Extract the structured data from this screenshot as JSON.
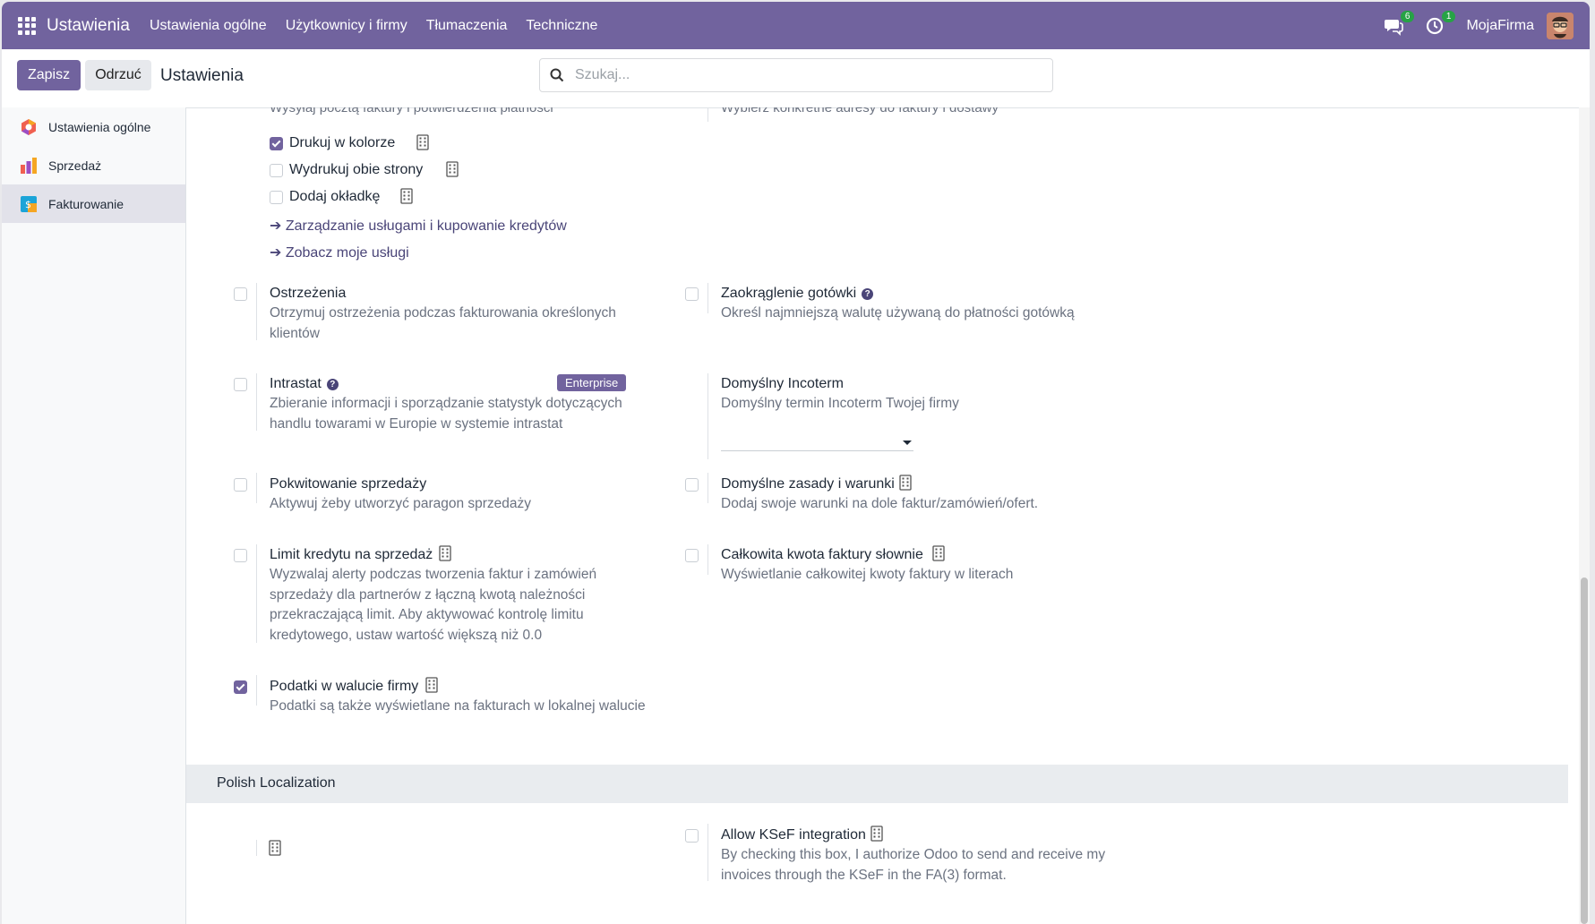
{
  "topbar": {
    "brand": "Ustawienia",
    "menu": [
      "Ustawienia ogólne",
      "Użytkownicy i firmy",
      "Tłumaczenia",
      "Techniczne"
    ],
    "messages_count": "6",
    "activities_count": "1",
    "company": "MojaFirma"
  },
  "controlbar": {
    "save_label": "Zapisz",
    "discard_label": "Odrzuć",
    "title": "Ustawienia",
    "search_placeholder": "Szukaj..."
  },
  "sidebar": {
    "items": [
      {
        "label": "Ustawienia ogólne",
        "active": false
      },
      {
        "label": "Sprzedaż",
        "active": false
      },
      {
        "label": "Fakturowanie",
        "active": true
      }
    ]
  },
  "content": {
    "clipped_left": "Wysyłaj pocztą faktury i potwierdzenia płatności",
    "clipped_right": "Wybierz konkretne adresy do faktury i dostawy",
    "print_options": [
      {
        "label": "Drukuj w kolorze",
        "checked": true
      },
      {
        "label": "Wydrukuj obie strony",
        "checked": false
      },
      {
        "label": "Dodaj okładkę",
        "checked": false
      }
    ],
    "links": [
      "Zarządzanie usługami i kupowanie kredytów",
      "Zobacz moje usługi"
    ],
    "settings": {
      "warnings": {
        "title": "Ostrzeżenia",
        "desc_lines": [
          "Otrzymuj ostrzeżenia podczas fakturowania określonych",
          "klientów"
        ],
        "checked": false
      },
      "cash_rounding": {
        "title": "Zaokrąglenie gotówki",
        "desc_lines": [
          "Określ najmniejszą walutę używaną do płatności gotówką"
        ],
        "checked": false
      },
      "intrastat": {
        "title": "Intrastat",
        "badge": "Enterprise",
        "desc_lines": [
          "Zbieranie informacji i sporządzanie statystyk dotyczących",
          "handlu towarami w Europie w systemie intrastat"
        ],
        "checked": false
      },
      "incoterm": {
        "title": "Domyślny Incoterm",
        "desc_lines": [
          "Domyślny termin Incoterm Twojej firmy"
        ],
        "value": ""
      },
      "sale_receipt": {
        "title": "Pokwitowanie sprzedaży",
        "desc_lines": [
          "Aktywuj żeby utworzyć paragon sprzedaży"
        ],
        "checked": false
      },
      "terms": {
        "title": "Domyślne zasady i warunki",
        "desc_lines": [
          "Dodaj swoje warunki na dole faktur/zamówień/ofert."
        ],
        "checked": false
      },
      "credit_limit": {
        "title": "Limit kredytu na sprzedaż",
        "desc_lines": [
          "Wyzwalaj alerty podczas tworzenia faktur i zamówień",
          "sprzedaży dla partnerów z łączną kwotą należności",
          "przekraczającą limit. Aby aktywować kontrolę limitu",
          "kredytowego, ustaw wartość większą niż 0.0"
        ],
        "checked": false
      },
      "amount_words": {
        "title": "Całkowita kwota faktury słownie",
        "desc_lines": [
          "Wyświetlanie całkowitej kwoty faktury w literach"
        ],
        "checked": false
      },
      "taxes_currency": {
        "title": "Podatki w walucie firmy",
        "desc_lines": [
          "Podatki są także wyświetlane na fakturach w lokalnej walucie"
        ],
        "checked": true
      }
    },
    "section_polish": "Polish Localization",
    "ksef": {
      "title": "Allow KSeF integration",
      "desc_lines": [
        "By checking this box, I authorize Odoo to send and receive my",
        "invoices through the KSeF in the FA(3) format."
      ],
      "checked": false
    }
  }
}
